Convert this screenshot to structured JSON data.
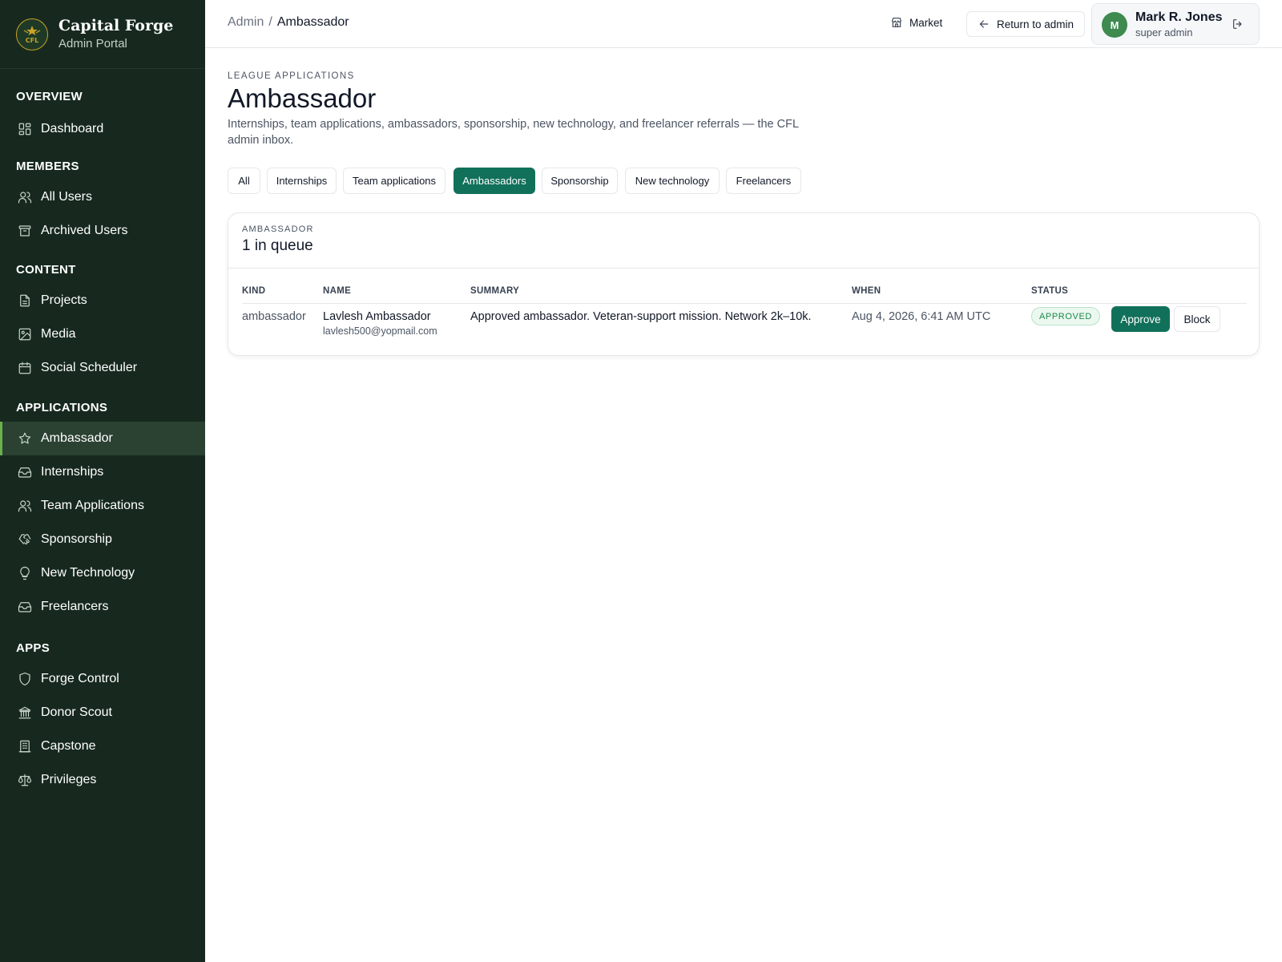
{
  "brand": {
    "name": "Capital Forge",
    "subtitle": "Admin Portal",
    "logo_text": "CFL"
  },
  "sidebar": {
    "sections": [
      {
        "title": "OVERVIEW",
        "items": [
          {
            "label": "Dashboard",
            "icon": "dashboard-icon"
          }
        ]
      },
      {
        "title": "MEMBERS",
        "items": [
          {
            "label": "All Users",
            "icon": "users-icon"
          },
          {
            "label": "Archived Users",
            "icon": "archive-icon"
          }
        ]
      },
      {
        "title": "CONTENT",
        "items": [
          {
            "label": "Projects",
            "icon": "document-icon"
          },
          {
            "label": "Media",
            "icon": "image-icon"
          },
          {
            "label": "Social Scheduler",
            "icon": "calendar-icon"
          }
        ]
      },
      {
        "title": "APPLICATIONS",
        "items": [
          {
            "label": "Ambassador",
            "icon": "star-icon",
            "active": true
          },
          {
            "label": "Internships",
            "icon": "inbox-icon"
          },
          {
            "label": "Team Applications",
            "icon": "users-icon"
          },
          {
            "label": "Sponsorship",
            "icon": "handshake-icon"
          },
          {
            "label": "New Technology",
            "icon": "lightbulb-icon"
          },
          {
            "label": "Freelancers",
            "icon": "inbox-icon"
          }
        ]
      },
      {
        "title": "APPS",
        "items": [
          {
            "label": "Forge Control",
            "icon": "shield-icon"
          },
          {
            "label": "Donor Scout",
            "icon": "bank-icon"
          },
          {
            "label": "Capstone",
            "icon": "building-icon"
          },
          {
            "label": "Privileges",
            "icon": "scale-icon"
          }
        ]
      }
    ]
  },
  "topbar": {
    "breadcrumb": {
      "root": "Admin",
      "separator": "/",
      "current": "Ambassador"
    },
    "market_label": "Market",
    "return_label": "Return to admin",
    "user": {
      "initial": "M",
      "name": "Mark R. Jones",
      "role": "super admin"
    }
  },
  "page": {
    "eyebrow": "LEAGUE APPLICATIONS",
    "title": "Ambassador",
    "description": "Internships, team applications, ambassadors, sponsorship, new technology, and freelancer referrals — the CFL admin inbox."
  },
  "tabs": [
    {
      "label": "All",
      "active": false
    },
    {
      "label": "Internships",
      "active": false
    },
    {
      "label": "Team applications",
      "active": false
    },
    {
      "label": "Ambassadors",
      "active": true
    },
    {
      "label": "Sponsorship",
      "active": false
    },
    {
      "label": "New technology",
      "active": false
    },
    {
      "label": "Freelancers",
      "active": false
    }
  ],
  "queue": {
    "eyebrow": "AMBASSADOR",
    "count_label": "1 in queue",
    "columns": {
      "kind": "KIND",
      "name": "NAME",
      "summary": "SUMMARY",
      "when": "WHEN",
      "status": "STATUS"
    },
    "rows": [
      {
        "kind": "ambassador",
        "name": "Lavlesh Ambassador",
        "email": "lavlesh500@yopmail.com",
        "summary": "Approved ambassador. Veteran-support mission. Network 2k–10k.",
        "when": "Aug 4, 2026, 6:41 AM UTC",
        "status": "APPROVED",
        "approve_label": "Approve",
        "block_label": "Block"
      }
    ]
  },
  "colors": {
    "sidebar_bg": "#17291f",
    "accent": "#11705a",
    "active_bar": "#6ab04c",
    "approved_text": "#1c8a4d"
  }
}
